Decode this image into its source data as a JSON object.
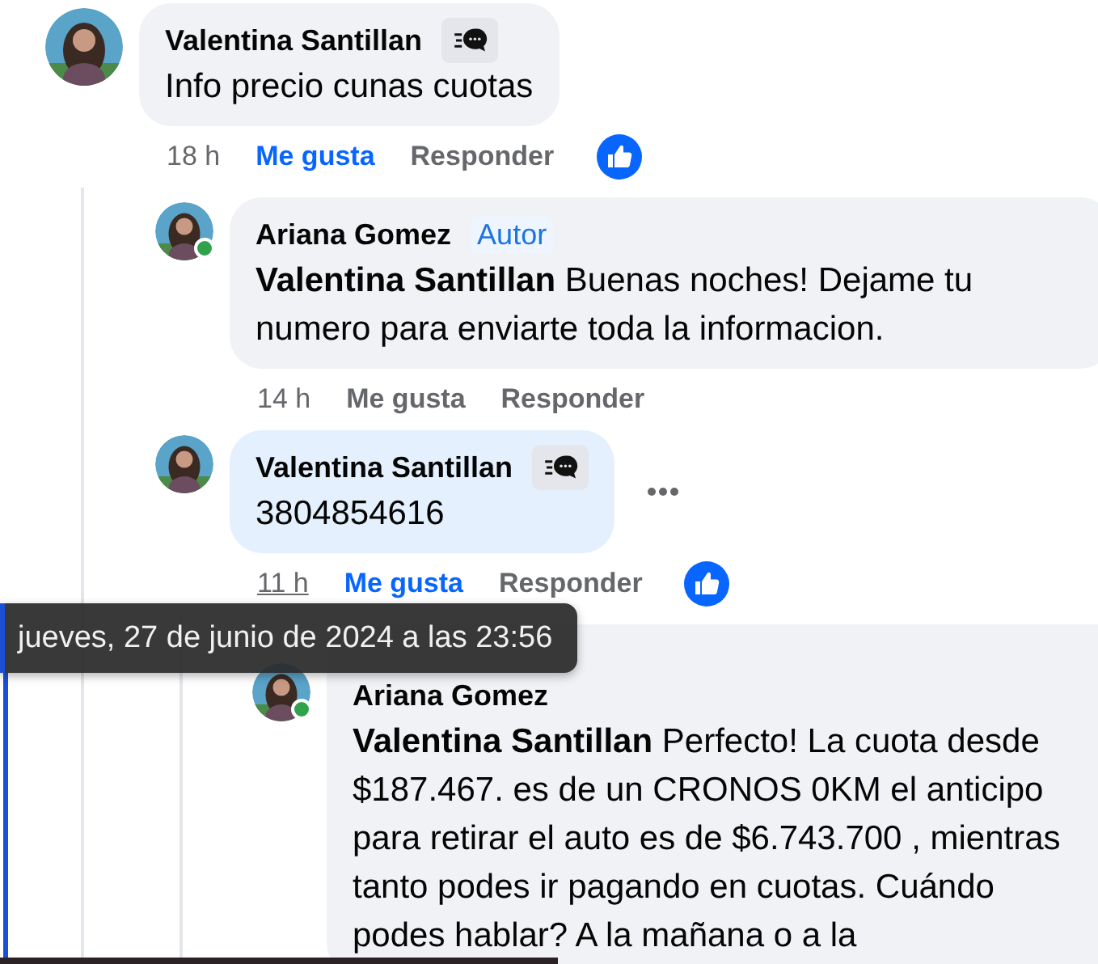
{
  "comments": [
    {
      "author": "Valentina Santillan",
      "starter_badge": true,
      "text": "Info precio cunas cuotas",
      "highlighted": false,
      "online": false,
      "more_menu": false,
      "time": "18 h",
      "time_hovered": false,
      "like_label": "Me gusta",
      "like_active": true,
      "reply_label": "Responder",
      "reaction": true,
      "replies": [
        {
          "author": "Ariana Gomez",
          "starter_badge": false,
          "author_badge": "Autor",
          "mention": "Valentina Santillan",
          "text": "Buenas noches! Dejame tu numero para enviarte toda la informacion.",
          "highlighted": false,
          "online": true,
          "more_menu": false,
          "time": "14 h",
          "time_hovered": false,
          "like_label": "Me gusta",
          "like_active": false,
          "reply_label": "Responder",
          "reaction": false
        },
        {
          "author": "Valentina Santillan",
          "starter_badge": true,
          "text": "3804854616",
          "highlighted": true,
          "online": false,
          "more_menu": true,
          "time": "11 h",
          "time_hovered": true,
          "like_label": "Me gusta",
          "like_active": true,
          "reply_label": "Responder",
          "reaction": true,
          "replies": [
            {
              "author": "Ariana Gomez",
              "starter_badge": false,
              "mention": "Valentina Santillan",
              "text": "Perfecto! La cuota desde $187.467. es de un CRONOS 0KM el anticipo para retirar el auto es de $6.743.700 , mientras tanto podes ir pagando en cuotas. Cuándo podes hablar? A la mañana o a la",
              "highlighted": false,
              "online": true,
              "more_menu": false
            }
          ]
        }
      ]
    }
  ],
  "tooltip": "jueves, 27 de junio de 2024 a las 23:56"
}
